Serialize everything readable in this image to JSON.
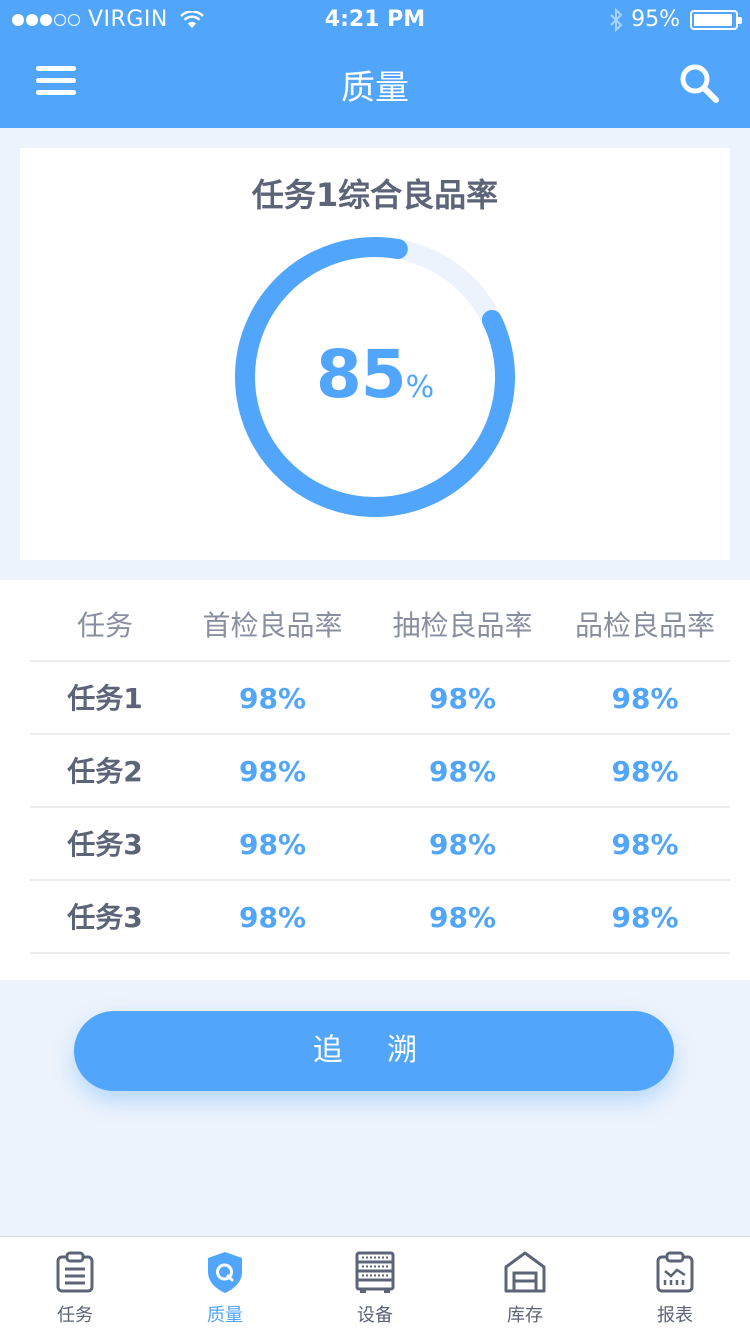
{
  "status_bar": {
    "carrier": "VIRGIN",
    "time": "4:21 PM",
    "battery": "95%",
    "battery_level": 0.95,
    "signal_bars": 3,
    "signal_total": 5
  },
  "header": {
    "title": "质量",
    "left_icon": "menu-icon",
    "right_icon": "search-icon"
  },
  "summary": {
    "title": "任务1综合良品率",
    "value": "85",
    "unit": "%",
    "progress": 0.85
  },
  "table": {
    "headers": [
      "任务",
      "首检良品率",
      "抽检良品率",
      "品检良品率"
    ],
    "rows": [
      {
        "name": "任务1",
        "values": [
          "98%",
          "98%",
          "98%"
        ]
      },
      {
        "name": "任务2",
        "values": [
          "98%",
          "98%",
          "98%"
        ]
      },
      {
        "name": "任务3",
        "values": [
          "98%",
          "98%",
          "98%"
        ]
      },
      {
        "name": "任务3",
        "values": [
          "98%",
          "98%",
          "98%"
        ]
      }
    ]
  },
  "actions": {
    "trace_label": "追 溯"
  },
  "tabbar": {
    "items": [
      {
        "label": "任务",
        "icon": "clipboard-list-icon",
        "active": false
      },
      {
        "label": "质量",
        "icon": "shield-q-icon",
        "active": true
      },
      {
        "label": "设备",
        "icon": "server-rack-icon",
        "active": false
      },
      {
        "label": "库存",
        "icon": "warehouse-icon",
        "active": false
      },
      {
        "label": "报表",
        "icon": "report-chart-icon",
        "active": false
      }
    ]
  },
  "colors": {
    "accent": "#51a6fc",
    "text_dark": "#5d6478",
    "text_muted": "#8a8fa0",
    "background": "#edf3fc",
    "gauge_track": "#edf3fc"
  }
}
